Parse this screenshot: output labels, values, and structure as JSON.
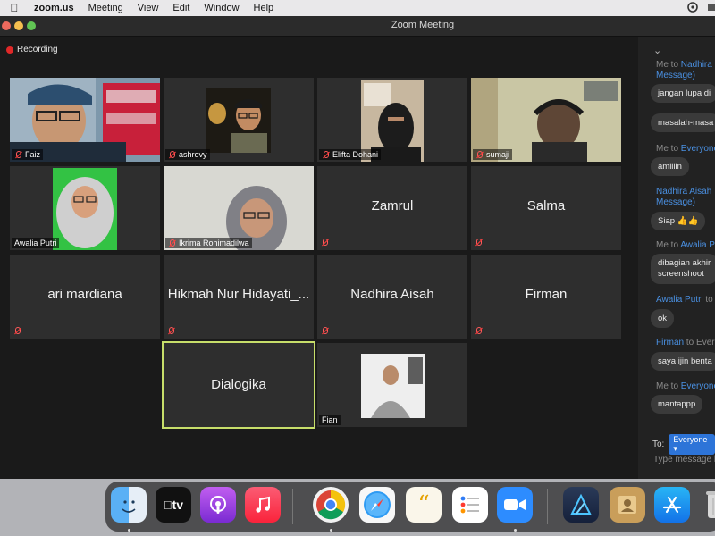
{
  "menubar": {
    "app": "zoom.us",
    "items": [
      "Meeting",
      "View",
      "Edit",
      "Window",
      "Help"
    ]
  },
  "window": {
    "title": "Zoom Meeting"
  },
  "recording": {
    "label": "Recording"
  },
  "tiles": [
    {
      "name": "Faiz",
      "video": true
    },
    {
      "name": "ashrovy",
      "video": true
    },
    {
      "name": "Elifta Dohani",
      "video": true
    },
    {
      "name": "sumaji",
      "video": true
    },
    {
      "name": "Awalia Putri",
      "video": true
    },
    {
      "name": "Ikrima Rohimadilwa",
      "video": true
    },
    {
      "name": "Zamrul",
      "video": false
    },
    {
      "name": "Salma",
      "video": false
    },
    {
      "name": "ari mardiana",
      "video": false
    },
    {
      "name": "Hikmah Nur Hidayati_...",
      "video": false
    },
    {
      "name": "Nadhira Aisah",
      "video": false
    },
    {
      "name": "Firman",
      "video": false
    },
    {
      "name": "Dialogika",
      "video": false,
      "active": true
    },
    {
      "name": "Fian",
      "video": true
    }
  ],
  "chat": {
    "messages": [
      {
        "meta_pre": "Me to ",
        "meta_to": "Nadhira",
        "meta_post": "",
        "meta_line2": "Message)",
        "text": "jangan lupa di"
      },
      {
        "meta_pre": "",
        "meta_to": "",
        "meta_post": "",
        "text": "masalah-masa"
      },
      {
        "meta_pre": "Me to ",
        "meta_to": "Everyone",
        "meta_post": "",
        "text": "amiiiin"
      },
      {
        "meta_pre": "",
        "meta_to": "Nadhira Aisah",
        "meta_post": "",
        "meta_line2": "Message)",
        "text": "Siap 👍👍"
      },
      {
        "meta_pre": "Me to ",
        "meta_to": "Awalia P",
        "meta_post": "",
        "text": "dibagian akhir",
        "text2": "screenshoot"
      },
      {
        "meta_pre": "",
        "meta_to": "Awalia Putri",
        "meta_post": " to",
        "text": "ok"
      },
      {
        "meta_pre": "",
        "meta_to": "Firman",
        "meta_post": " to Ever",
        "text": "saya ijin benta"
      },
      {
        "meta_pre": "Me to ",
        "meta_to": "Everyone",
        "meta_post": "",
        "text": "mantappp"
      }
    ],
    "to_label": "To:",
    "to_value": "Everyone",
    "placeholder": "Type message h"
  },
  "dock": {
    "icons": [
      "finder-icon",
      "apple-tv-icon",
      "podcasts-icon",
      "music-icon",
      "chrome-icon",
      "safari-icon",
      "quotes-app-icon",
      "reminders-icon",
      "zoom-icon",
      "affinity-designer-icon",
      "contacts-icon",
      "app-store-icon",
      "trash-icon"
    ],
    "tv_label": "tv"
  }
}
